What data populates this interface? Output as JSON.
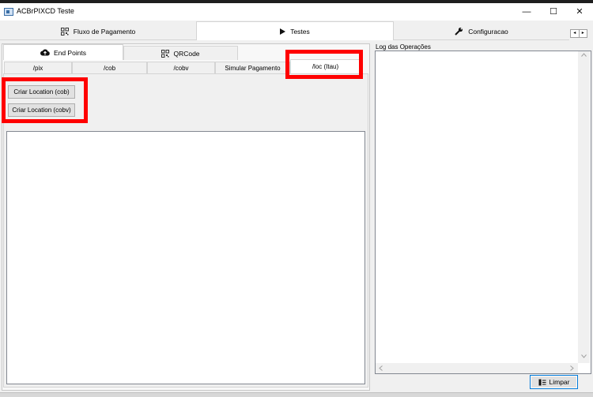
{
  "window": {
    "title": "ACBrPIXCD Teste",
    "controls": {
      "minimize": "—",
      "maximize": "☐",
      "close": "✕"
    }
  },
  "main_tabs": [
    {
      "label": "Fluxo de Pagamento",
      "icon": "qrcode-icon"
    },
    {
      "label": "Testes",
      "icon": "play-icon",
      "active": true
    },
    {
      "label": "Configuracao",
      "icon": "wrench-icon"
    }
  ],
  "tab_scroll": {
    "left": "◂",
    "right": "▸"
  },
  "sub_tabs": [
    {
      "label": "End Points",
      "icon": "cloud-upload-icon",
      "active": true
    },
    {
      "label": "QRCode",
      "icon": "qrcode-icon"
    }
  ],
  "endpoint_tabs": [
    {
      "label": "/pix"
    },
    {
      "label": "/cob"
    },
    {
      "label": "/cobv"
    },
    {
      "label": "Simular Pagamento"
    },
    {
      "label": "/loc (Itau)",
      "active": true
    }
  ],
  "buttons": {
    "criar_location_cob": "Criar Location (cob)",
    "criar_location_cobv": "Criar Location (cobv)",
    "limpar": "Limpar"
  },
  "log": {
    "label": "Log das Operações"
  },
  "colors": {
    "highlight": "#ff0000",
    "focus_border": "#0078d7"
  }
}
